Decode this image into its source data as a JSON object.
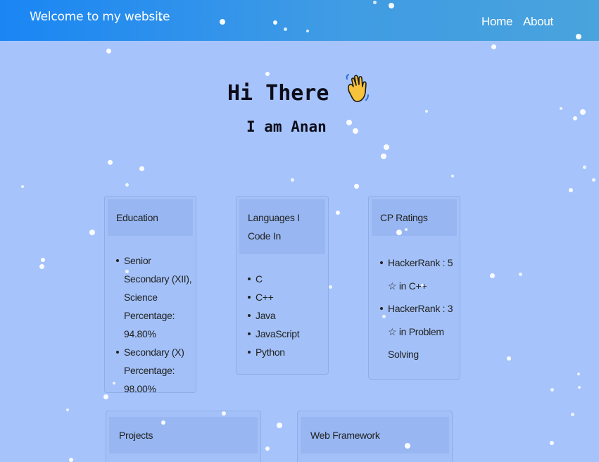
{
  "navbar": {
    "brand": "Welcome to my website",
    "links": [
      {
        "label": "Home"
      },
      {
        "label": "About"
      }
    ]
  },
  "hero": {
    "title": "Hi There",
    "subtitle": "I am Anan",
    "icon": "waving-hand-icon"
  },
  "cards": {
    "education": {
      "title": "Education",
      "items": [
        "Senior Secondary (XII), Science Percentage: 94.80%",
        "Secondary (X) Percentage: 98.00%"
      ]
    },
    "languages": {
      "title": "Languages I Code In",
      "items": [
        "C",
        "C++",
        "Java",
        "JavaScript",
        "Python"
      ]
    },
    "cp_ratings": {
      "title": "CP Ratings",
      "items": [
        "HackerRank : 5 ☆ in C++",
        "HackerRank : 3 ☆ in Problem Solving"
      ]
    },
    "projects": {
      "title": "Projects"
    },
    "web_framework": {
      "title": "Web Framework"
    }
  },
  "colors": {
    "background": "#a6c4fb",
    "navbar_start": "#1a86f4",
    "navbar_end": "#49a3dc",
    "text": "#222222"
  }
}
